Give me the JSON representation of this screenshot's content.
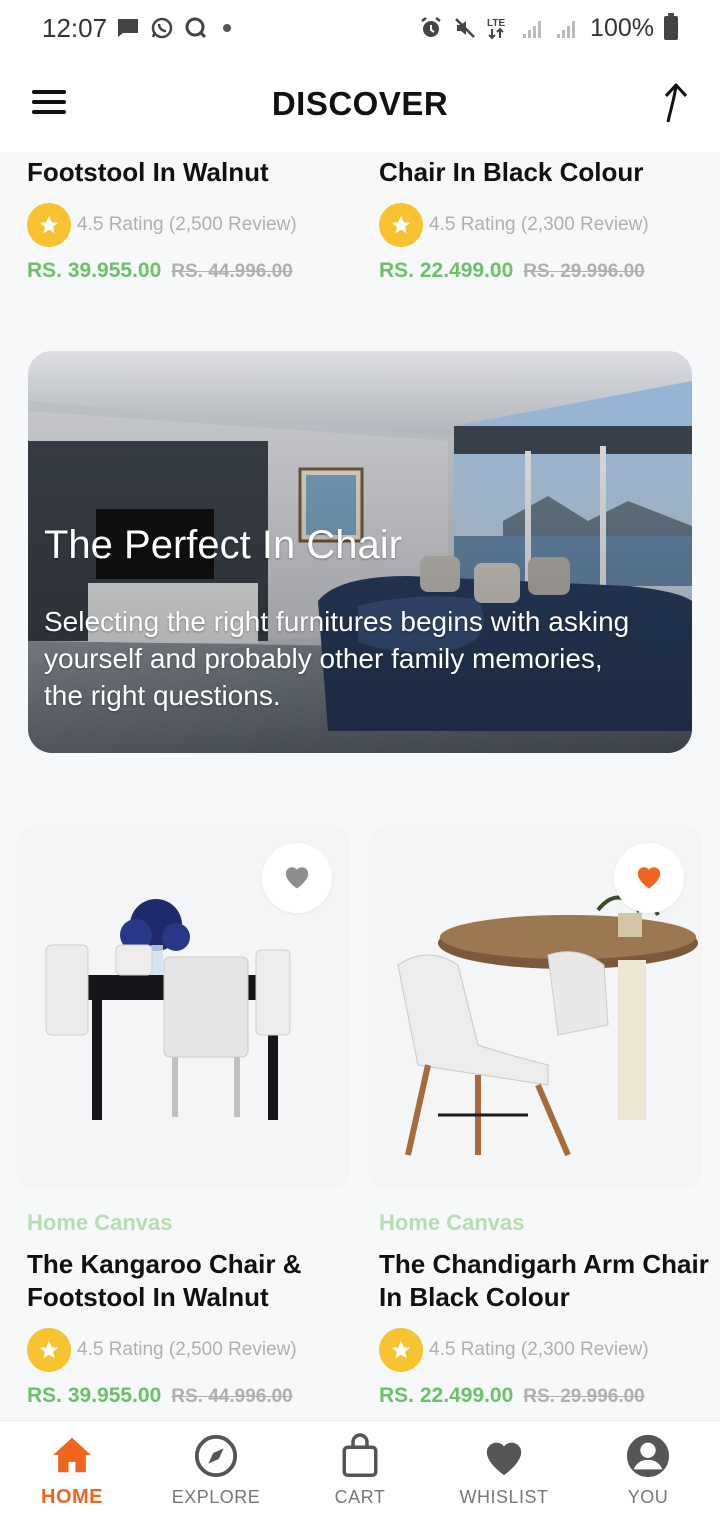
{
  "status_bar": {
    "time": "12:07",
    "battery": "100%",
    "icons": [
      "message-icon",
      "whatsapp-icon",
      "chat-icon",
      "alarm-icon",
      "mute-icon",
      "lte-icon",
      "signal-icon",
      "battery-icon"
    ],
    "lte": "LTE"
  },
  "header": {
    "title": "DISCOVER",
    "menu_icon": "hamburger-menu-icon",
    "share_icon": "share-arrow-icon"
  },
  "top_products": [
    {
      "name": "Footstool In Walnut",
      "rating": "4.5 Rating (2,500 Review)",
      "price": "RS. 39.955.00",
      "old_price": "RS. 44.996.00"
    },
    {
      "name": "Chair In Black Colour",
      "rating": "4.5 Rating (2,300 Review)",
      "price": "RS. 22.499.00",
      "old_price": "RS. 29.996.00"
    }
  ],
  "banner": {
    "title": "The Perfect In Chair",
    "description": "Selecting the right furnitures begins with asking yourself and probably other family memories, the right questions."
  },
  "products": [
    {
      "brand": "Home Canvas",
      "name": "The Kangaroo Chair & Footstool In Walnut",
      "rating": "4.5 Rating (2,500 Review)",
      "price": "RS. 39.955.00",
      "old_price": "RS. 44.996.00",
      "favorited": false
    },
    {
      "brand": "Home Canvas",
      "name": "The Chandigarh Arm Chair In Black Colour",
      "rating": "4.5 Rating (2,300 Review)",
      "price": "RS. 22.499.00",
      "old_price": "RS. 29.996.00",
      "favorited": true
    }
  ],
  "bottom_nav": {
    "items": [
      {
        "label": "HOME",
        "icon": "home-icon",
        "active": true
      },
      {
        "label": "EXPLORE",
        "icon": "compass-icon",
        "active": false
      },
      {
        "label": "CART",
        "icon": "shopping-bag-icon",
        "active": false
      },
      {
        "label": "WHISLIST",
        "icon": "heart-icon",
        "active": false
      },
      {
        "label": "YOU",
        "icon": "user-icon",
        "active": false
      }
    ]
  },
  "colors": {
    "accent_orange": "#f0651e",
    "price_green": "#6cc06a",
    "brand_green": "#b8dcb4",
    "star_yellow": "#f7c330",
    "muted_gray": "#b0b0b0"
  }
}
